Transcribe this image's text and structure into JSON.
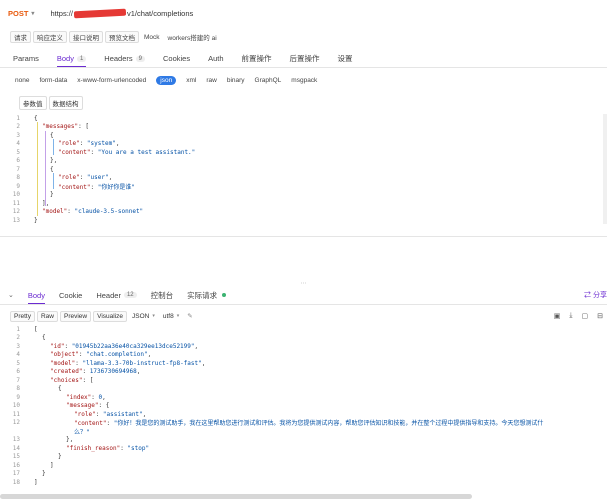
{
  "request": {
    "method": "POST",
    "url_prefix": "https://",
    "url_suffix": "v1/chat/completions"
  },
  "chips": [
    "请求",
    "响应定义",
    "接口说明",
    "预览文档",
    "Mock",
    "workers搭建的 ai"
  ],
  "request_tabs": [
    {
      "label": "Params",
      "badge": ""
    },
    {
      "label": "Body",
      "badge": "1",
      "active": true
    },
    {
      "label": "Headers",
      "badge": "9"
    },
    {
      "label": "Cookies",
      "badge": ""
    },
    {
      "label": "Auth",
      "badge": ""
    },
    {
      "label": "前置操作",
      "badge": ""
    },
    {
      "label": "后置操作",
      "badge": ""
    },
    {
      "label": "设置",
      "badge": ""
    }
  ],
  "body_types": [
    "none",
    "form-data",
    "x-www-form-urlencoded",
    "json",
    "xml",
    "raw",
    "binary",
    "GraphQL",
    "msgpack"
  ],
  "body_active": "json",
  "sub_buttons": [
    "参数值",
    "数据结构"
  ],
  "request_code": [
    {
      "ln": "1",
      "indent": 0,
      "parts": [
        [
          "p",
          "{"
        ]
      ]
    },
    {
      "ln": "2",
      "indent": 1,
      "parts": [
        [
          "k",
          "\"messages\""
        ],
        [
          "p",
          ": ["
        ]
      ]
    },
    {
      "ln": "3",
      "indent": 2,
      "parts": [
        [
          "p",
          "{"
        ]
      ]
    },
    {
      "ln": "4",
      "indent": 3,
      "parts": [
        [
          "k",
          "\"role\""
        ],
        [
          "p",
          ": "
        ],
        [
          "s",
          "\"system\""
        ],
        [
          "p",
          ","
        ]
      ]
    },
    {
      "ln": "5",
      "indent": 3,
      "parts": [
        [
          "k",
          "\"content\""
        ],
        [
          "p",
          ": "
        ],
        [
          "s",
          "\"You are a test assistant.\""
        ]
      ]
    },
    {
      "ln": "6",
      "indent": 2,
      "parts": [
        [
          "p",
          "},"
        ]
      ]
    },
    {
      "ln": "7",
      "indent": 2,
      "parts": [
        [
          "p",
          "{"
        ]
      ]
    },
    {
      "ln": "8",
      "indent": 3,
      "parts": [
        [
          "k",
          "\"role\""
        ],
        [
          "p",
          ": "
        ],
        [
          "s",
          "\"user\""
        ],
        [
          "p",
          ","
        ]
      ]
    },
    {
      "ln": "9",
      "indent": 3,
      "parts": [
        [
          "k",
          "\"content\""
        ],
        [
          "p",
          ": "
        ],
        [
          "s",
          "\"你好你是谁\""
        ]
      ]
    },
    {
      "ln": "10",
      "indent": 2,
      "parts": [
        [
          "p",
          "}"
        ]
      ]
    },
    {
      "ln": "11",
      "indent": 1,
      "parts": [
        [
          "p",
          "],"
        ]
      ]
    },
    {
      "ln": "12",
      "indent": 1,
      "parts": [
        [
          "k",
          "\"model\""
        ],
        [
          "p",
          ": "
        ],
        [
          "s",
          "\"claude-3.5-sonnet\""
        ]
      ]
    },
    {
      "ln": "13",
      "indent": 0,
      "parts": [
        [
          "p",
          "}"
        ]
      ]
    }
  ],
  "response_tabs": [
    {
      "label": "Body",
      "badge": "",
      "active": true
    },
    {
      "label": "Cookie",
      "badge": ""
    },
    {
      "label": "Header",
      "badge": "12"
    },
    {
      "label": "控制台",
      "badge": ""
    },
    {
      "label": "实际请求",
      "badge": "",
      "dot": true
    }
  ],
  "share_label": "分享",
  "response_tools": [
    "Pretty",
    "Raw",
    "Preview",
    "Visualize"
  ],
  "response_format": "JSON",
  "response_encoding": "utf8",
  "response_code": [
    {
      "ln": "1",
      "indent": 0,
      "parts": [
        [
          "p",
          "["
        ]
      ]
    },
    {
      "ln": "2",
      "indent": 1,
      "parts": [
        [
          "p",
          "{"
        ]
      ]
    },
    {
      "ln": "3",
      "indent": 2,
      "parts": [
        [
          "k",
          "\"id\""
        ],
        [
          "p",
          ": "
        ],
        [
          "s",
          "\"01945b22aa36e40ca329ee13dce52199\""
        ],
        [
          "p",
          ","
        ]
      ]
    },
    {
      "ln": "4",
      "indent": 2,
      "parts": [
        [
          "k",
          "\"object\""
        ],
        [
          "p",
          ": "
        ],
        [
          "s",
          "\"chat.completion\""
        ],
        [
          "p",
          ","
        ]
      ]
    },
    {
      "ln": "5",
      "indent": 2,
      "parts": [
        [
          "k",
          "\"model\""
        ],
        [
          "p",
          ": "
        ],
        [
          "s",
          "\"llama-3.3-70b-instruct-fp8-fast\""
        ],
        [
          "p",
          ","
        ]
      ]
    },
    {
      "ln": "6",
      "indent": 2,
      "parts": [
        [
          "k",
          "\"created\""
        ],
        [
          "p",
          ": "
        ],
        [
          "s",
          "1736730694968"
        ],
        [
          "p",
          ","
        ]
      ]
    },
    {
      "ln": "7",
      "indent": 2,
      "parts": [
        [
          "k",
          "\"choices\""
        ],
        [
          "p",
          ": ["
        ]
      ]
    },
    {
      "ln": "8",
      "indent": 3,
      "parts": [
        [
          "p",
          "{"
        ]
      ]
    },
    {
      "ln": "9",
      "indent": 4,
      "parts": [
        [
          "k",
          "\"index\""
        ],
        [
          "p",
          ": "
        ],
        [
          "s",
          "0"
        ],
        [
          "p",
          ","
        ]
      ]
    },
    {
      "ln": "10",
      "indent": 4,
      "parts": [
        [
          "k",
          "\"message\""
        ],
        [
          "p",
          ": {"
        ]
      ]
    },
    {
      "ln": "11",
      "indent": 5,
      "parts": [
        [
          "k",
          "\"role\""
        ],
        [
          "p",
          ": "
        ],
        [
          "s",
          "\"assistant\""
        ],
        [
          "p",
          ","
        ]
      ]
    },
    {
      "ln": "12",
      "indent": 5,
      "parts": [
        [
          "k",
          "\"content\""
        ],
        [
          "p",
          ": "
        ],
        [
          "s",
          "\"你好！我是您的测试助手，我在这里帮助您进行测试和评估。我将为您提供测试内容，帮助您评估知识和技能，并在整个过程中提供指导和支持。今天您想测试什"
        ]
      ]
    },
    {
      "ln": "",
      "indent": 5,
      "parts": [
        [
          "s",
          "么？\""
        ]
      ]
    },
    {
      "ln": "13",
      "indent": 4,
      "parts": [
        [
          "p",
          "},"
        ]
      ]
    },
    {
      "ln": "14",
      "indent": 4,
      "parts": [
        [
          "k",
          "\"finish_reason\""
        ],
        [
          "p",
          ": "
        ],
        [
          "s",
          "\"stop\""
        ]
      ]
    },
    {
      "ln": "15",
      "indent": 3,
      "parts": [
        [
          "p",
          "}"
        ]
      ]
    },
    {
      "ln": "16",
      "indent": 2,
      "parts": [
        [
          "p",
          "]"
        ]
      ]
    },
    {
      "ln": "17",
      "indent": 1,
      "parts": [
        [
          "p",
          "}"
        ]
      ]
    },
    {
      "ln": "18",
      "indent": 0,
      "parts": [
        [
          "p",
          "]"
        ]
      ]
    }
  ]
}
